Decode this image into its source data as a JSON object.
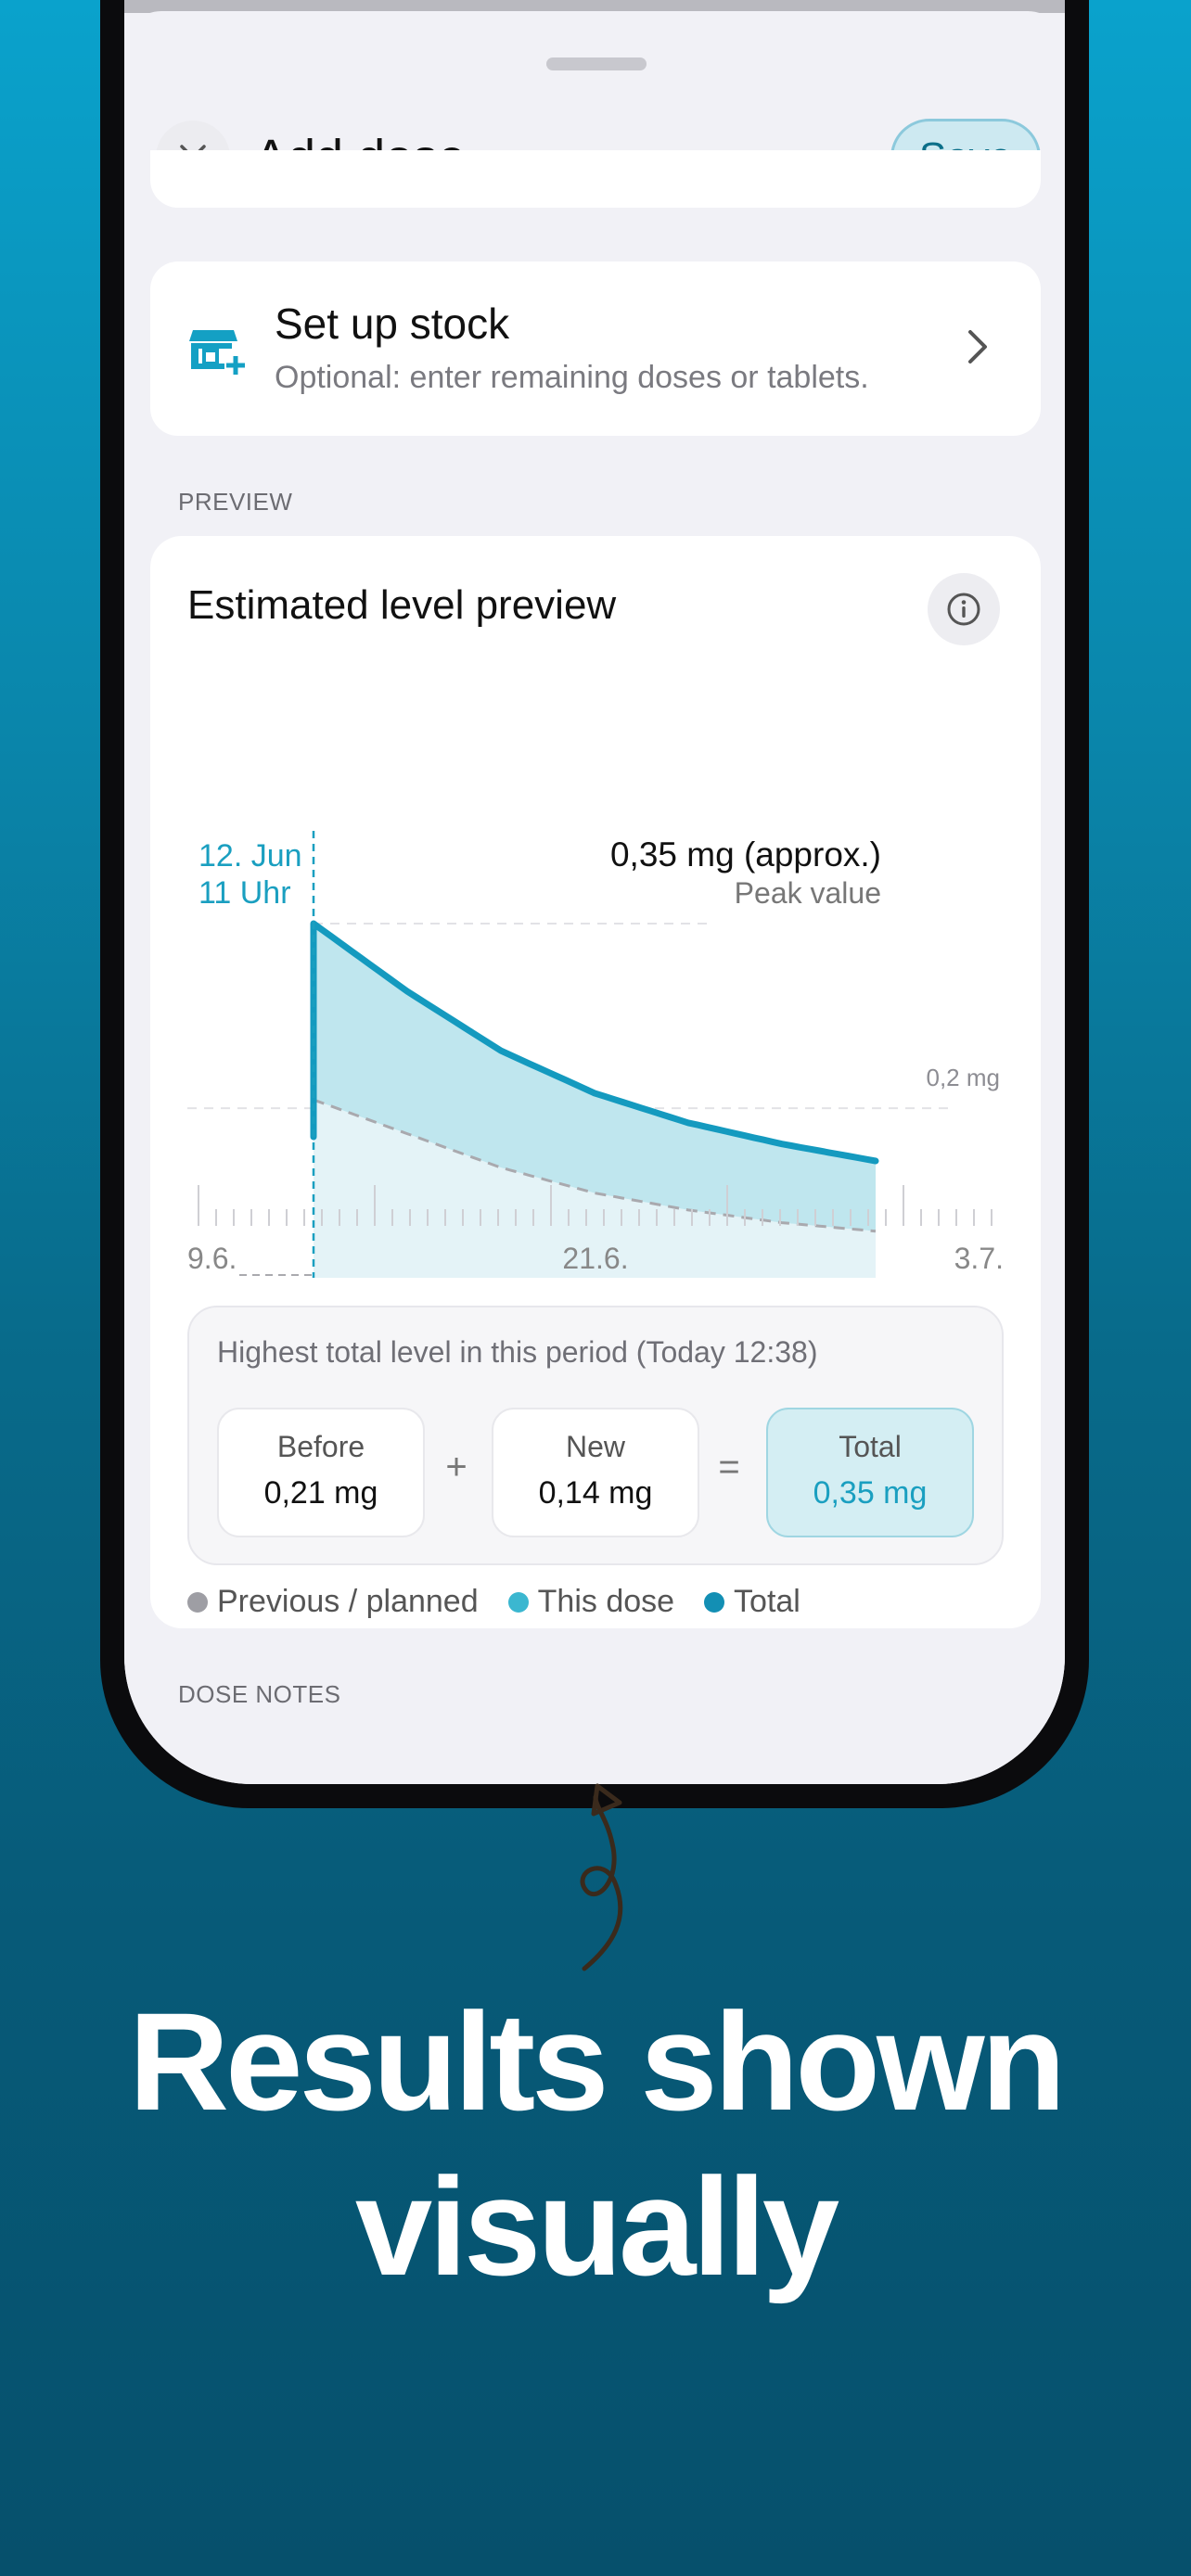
{
  "sheet": {
    "title": "Add dose",
    "save_label": "Save"
  },
  "stock": {
    "title": "Set up stock",
    "subtitle": "Optional: enter remaining doses or tablets."
  },
  "sections": {
    "preview_label": "PREVIEW",
    "notes_label": "DOSE NOTES"
  },
  "preview": {
    "title": "Estimated level preview",
    "marker_date": "12. Jun",
    "marker_time": "11 Uhr",
    "peak_value": "0,35 mg (approx.)",
    "peak_caption": "Peak value",
    "gridline_label": "0,2 mg",
    "x_ticks": [
      "9.6.",
      "21.6.",
      "3.7."
    ]
  },
  "chart_data": {
    "type": "area",
    "title": "Estimated level preview",
    "xlabel": "",
    "ylabel": "",
    "x_tick_labels": [
      "9.6.",
      "21.6.",
      "3.7."
    ],
    "dose_time": "12. Jun 11 Uhr",
    "reference_line": {
      "value": 0.2,
      "label": "0,2 mg"
    },
    "peak": {
      "value": 0.35,
      "label": "0,35 mg (approx.)"
    },
    "series": [
      {
        "name": "Previous / planned",
        "values": [
          0.21,
          0.17,
          0.13,
          0.1,
          0.08,
          0.065,
          0.055
        ]
      },
      {
        "name": "Total",
        "values": [
          0.35,
          0.27,
          0.2,
          0.15,
          0.115,
          0.09,
          0.07
        ]
      }
    ],
    "ylim": [
      0,
      0.42
    ],
    "legend": [
      "Previous / planned",
      "This dose",
      "Total"
    ]
  },
  "summary": {
    "heading": "Highest total level in this period (Today 12:38)",
    "before_label": "Before",
    "before_value": "0,21 mg",
    "plus": "+",
    "new_label": "New",
    "new_value": "0,14 mg",
    "equals": "=",
    "total_label": "Total",
    "total_value": "0,35 mg"
  },
  "legend": {
    "previous": "Previous / planned",
    "this_dose": "This dose",
    "total": "Total",
    "colors": {
      "previous": "#9e9ea4",
      "this_dose": "#3bb7d0",
      "total": "#138fb4"
    }
  },
  "headline": {
    "line1": "Results shown",
    "line2": "visually"
  }
}
